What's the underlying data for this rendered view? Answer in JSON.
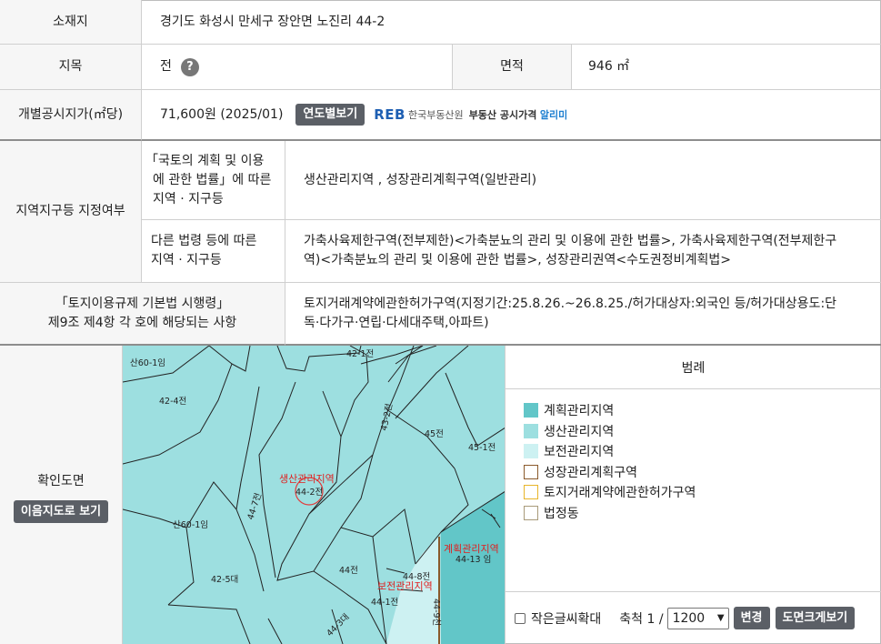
{
  "location": {
    "label": "소재지",
    "value": "경기도 화성시 만세구 장안면 노진리 44-2"
  },
  "land_category": {
    "label": "지목",
    "value": "전",
    "help_icon": "question-icon"
  },
  "area": {
    "label": "면적",
    "value": "946 ㎡"
  },
  "official_price": {
    "label": "개별공시지가(㎡당)",
    "value": "71,600원 (2025/01)",
    "year_button": "연도별보기",
    "reb_logo": "REB",
    "reb_org": "한국부동산원",
    "reb_slogan": "부동산 공시가격",
    "reb_alimi": "알리미"
  },
  "zoning": {
    "label": "지역지구등 지정여부",
    "law1_label_l1": "「국토의 계획 및 이용",
    "law1_label_l2": "에 관한 법률」에 따른",
    "law1_label_l3": "지역 · 지구등",
    "law1_value": "생산관리지역 , 성장관리계획구역(일반관리)",
    "law2_label_l1": "다른 법령 등에 따른",
    "law2_label_l2": "지역 · 지구등",
    "law2_value_l1": "가축사육제한구역(전부제한)<가축분뇨의 관리 및 이용에 관한 법률>, 가축사육제한구역(전부제한구",
    "law2_value_l2": "역)<가축분뇨의 관리 및 이용에 관한 법률>, 성장관리권역<수도권정비계획법>"
  },
  "regulation": {
    "label_l1": "「토지이용규제 기본법 시행령」",
    "label_l2": "제9조 제4항 각 호에 해당되는 사항",
    "value_l1": "토지거래계약에관한허가구역(지정기간:25.8.26.~26.8.25./허가대상자:외국인 등/허가대상용도:단",
    "value_l2": "독·다가구·연립·다세대주택,아파트)"
  },
  "map_section": {
    "label": "확인도면",
    "view_button": "이음지도로 보기",
    "parcels": [
      "산60-1임",
      "42-1전",
      "42-4전",
      "43-2전",
      "45전",
      "45-1전",
      "44-2전",
      "44-7전",
      "산60-1임",
      "42-5대",
      "44전",
      "44-8전",
      "44-1전",
      "44-13 임",
      "44-9천",
      "44-3대"
    ],
    "zone_labels": [
      "생산관리지역",
      "계획관리지역",
      "보전관리지역"
    ]
  },
  "legend": {
    "title": "범례",
    "items": [
      {
        "label": "계획관리지역",
        "fill": "#62c6c8",
        "border": "#62c6c8"
      },
      {
        "label": "생산관리지역",
        "fill": "#9ddfe0",
        "border": "#9ddfe0"
      },
      {
        "label": "보전관리지역",
        "fill": "#cdf1f2",
        "border": "#cdf1f2"
      },
      {
        "label": "성장관리계획구역",
        "fill": "#ffffff",
        "border": "#8a5a2b"
      },
      {
        "label": "토지거래계약에관한허가구역",
        "fill": "#ffffff",
        "border": "#e8b52a"
      },
      {
        "label": "법정동",
        "fill": "#ffffff",
        "border": "#a89a7a"
      }
    ],
    "small_text_label": "작은글씨확대",
    "scale_label": "축척 1 /",
    "scale_value": "1200",
    "change_button": "변경",
    "enlarge_button": "도면크게보기"
  }
}
